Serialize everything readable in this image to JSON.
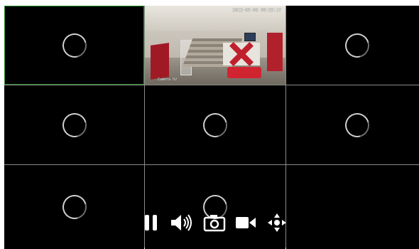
{
  "viewer": {
    "layout": "3x3",
    "selected_channel": 1,
    "channels": [
      {
        "channel": 1,
        "state": "loading"
      },
      {
        "channel": 2,
        "state": "live",
        "timestamp": "2013-05-06 09:25:17",
        "camera_label": "Camera 02"
      },
      {
        "channel": 3,
        "state": "loading"
      },
      {
        "channel": 4,
        "state": "loading"
      },
      {
        "channel": 5,
        "state": "loading"
      },
      {
        "channel": 6,
        "state": "loading"
      },
      {
        "channel": 7,
        "state": "loading"
      },
      {
        "channel": 8,
        "state": "loading"
      },
      {
        "channel": 9,
        "state": "empty"
      }
    ]
  },
  "controls": {
    "icons": [
      "pause-icon",
      "volume-icon",
      "camera-icon",
      "video-camera-icon",
      "move-icon"
    ],
    "color": "#ffffff"
  },
  "colors": {
    "background": "#000000",
    "grid_lines": "#8a8a8a",
    "selection": "#2f8f2f"
  }
}
